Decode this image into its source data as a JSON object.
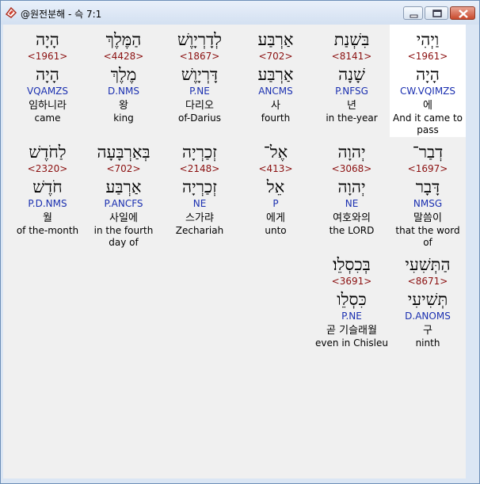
{
  "window": {
    "title": "@원전분해 - 슥 7:1",
    "app_icon": "book-flag-icon",
    "controls": [
      "minimize-icon",
      "maximize-icon",
      "close-icon"
    ]
  },
  "colors": {
    "strongs": "#8b1010",
    "morphology": "#1a2fb0",
    "text": "#000000",
    "background": "#f0f0f0",
    "highlight": "#ffffff"
  },
  "rows": [
    [
      {
        "hebrew": "וַיְהִי",
        "strongs": "<1961>",
        "lemma": "הָיָה",
        "morph": "CW.VQIMZS",
        "korean": "에",
        "english": "And it came to pass",
        "highlight": true
      },
      {
        "hebrew": "בִּשְׁנַת",
        "strongs": "<8141>",
        "lemma": "שָׁנָה",
        "morph": "P.NFSG",
        "korean": "년",
        "english": "in the-year"
      },
      {
        "hebrew": "אַרְבַּע",
        "strongs": "<702>",
        "lemma": "אַרְבַּע",
        "morph": "ANCMS",
        "korean": "사",
        "english": "fourth"
      },
      {
        "hebrew": "לְדָרְיָוֶשׁ",
        "strongs": "<1867>",
        "lemma": "דָּרְיָוֶשׁ",
        "morph": "P.NE",
        "korean": "다리오",
        "english": "of-Darius"
      },
      {
        "hebrew": "הַמֶּלֶךְ",
        "strongs": "<4428>",
        "lemma": "מֶלֶךְ",
        "morph": "D.NMS",
        "korean": "왕",
        "english": "king"
      },
      {
        "hebrew": "הָיָה",
        "strongs": "<1961>",
        "lemma": "הָיָה",
        "morph": "VQAMZS",
        "korean": "임하니라",
        "english": "came"
      }
    ],
    [
      {
        "hebrew": "דְבַר־",
        "strongs": "<1697>",
        "lemma": "דָּבָר",
        "morph": "NMSG",
        "korean": "말씀이",
        "english": "that the word of"
      },
      {
        "hebrew": "יְהוָה",
        "strongs": "<3068>",
        "lemma": "יְהוָה",
        "morph": "NE",
        "korean": "여호와의",
        "english": "the LORD"
      },
      {
        "hebrew": "אֶל־",
        "strongs": "<413>",
        "lemma": "אֵל",
        "morph": "P",
        "korean": "에게",
        "english": "unto"
      },
      {
        "hebrew": "זְכַרְיָה",
        "strongs": "<2148>",
        "lemma": "זְכַרְיָה",
        "morph": "NE",
        "korean": "스가랴",
        "english": "Zechariah"
      },
      {
        "hebrew": "בְּאַרְבָּעָה",
        "strongs": "<702>",
        "lemma": "אַרְבַּע",
        "morph": "P.ANCFS",
        "korean": "사일에",
        "english": "in the fourth day of"
      },
      {
        "hebrew": "לַחֹדֶשׁ",
        "strongs": "<2320>",
        "lemma": "חֹדֶשׁ",
        "morph": "P.D.NMS",
        "korean": "월",
        "english": "of the-month"
      }
    ],
    [
      {
        "hebrew": "הַתְּשִׁעִי",
        "strongs": "<8671>",
        "lemma": "תְּשִׁיעִי",
        "morph": "D.ANOMS",
        "korean": "구",
        "english": "ninth"
      },
      {
        "hebrew": "בְּכִסְלֵו׃",
        "strongs": "<3691>",
        "lemma": "כִּסְלֵו",
        "morph": "P.NE",
        "korean": "곧 기슬래월",
        "english": "even in Chisleu"
      }
    ]
  ]
}
